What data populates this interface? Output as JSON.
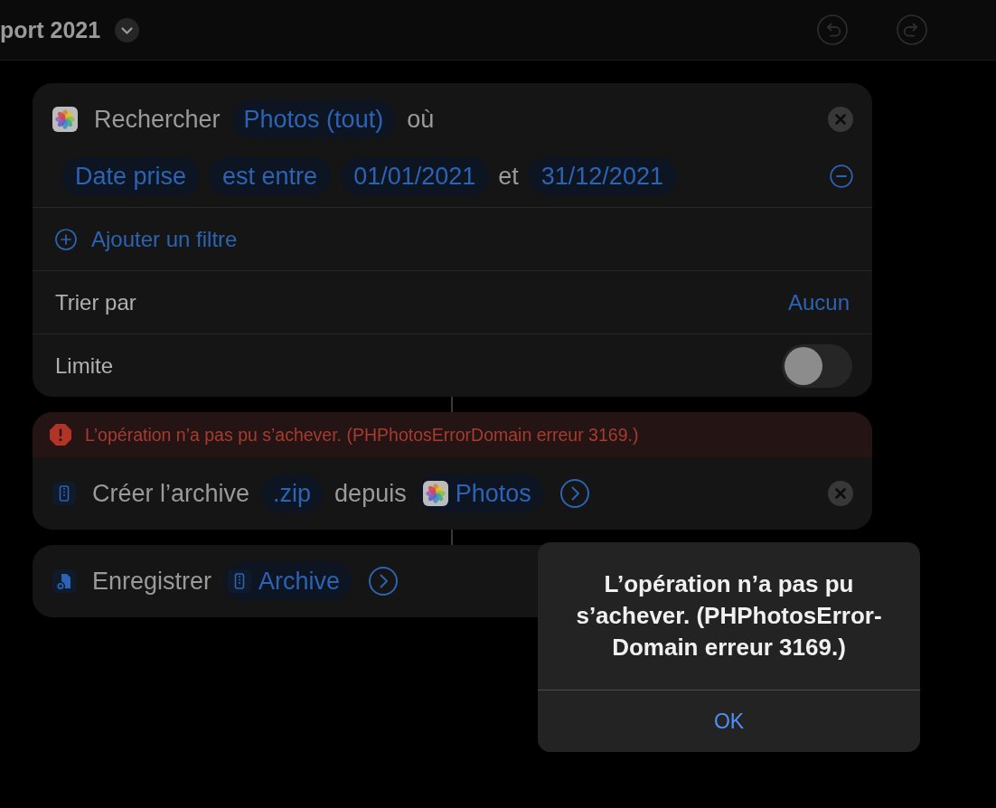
{
  "toolbar": {
    "title": "port 2021",
    "buttons": [
      {
        "kind": "undo",
        "disabled": true
      },
      {
        "kind": "redo",
        "disabled": true
      }
    ]
  },
  "actions": [
    {
      "kind": "search",
      "removable": true,
      "expandable": false,
      "tokens": [
        {
          "kind": "text",
          "text": "Rechercher"
        },
        {
          "kind": "param",
          "text": "Photos (tout)"
        },
        {
          "kind": "text",
          "text": "où"
        }
      ],
      "filters": [
        {
          "tokens": [
            {
              "kind": "param",
              "text": "Date prise"
            },
            {
              "kind": "param",
              "text": "est entre"
            },
            {
              "kind": "param",
              "text": "01/01/2021"
            },
            {
              "kind": "text",
              "text": "et"
            },
            {
              "kind": "param",
              "text": "31/12/2021"
            }
          ]
        }
      ],
      "add_filter": "Ajouter un filtre",
      "options": [
        {
          "kind": "value",
          "label": "Trier par",
          "value": "Aucun"
        },
        {
          "kind": "toggle",
          "label": "Limite",
          "on": false
        }
      ]
    },
    {
      "kind": "archive",
      "error": "L’opération n’a pas pu s’achever. (PHPhotosErrorDomain erreur 3169.)",
      "removable": true,
      "expandable": true,
      "tokens": [
        {
          "kind": "text",
          "text": "Créer l’archive"
        },
        {
          "kind": "param",
          "text": ".zip"
        },
        {
          "kind": "text",
          "text": "depuis"
        },
        {
          "kind": "photos",
          "text": "Photos"
        }
      ]
    },
    {
      "kind": "save",
      "removable": false,
      "expandable": true,
      "tokens": [
        {
          "kind": "text",
          "text": "Enregistrer"
        },
        {
          "kind": "archive",
          "text": "Archive"
        }
      ]
    }
  ],
  "alert": {
    "message": "L’opération n’a pas pu s’achever. (PHPhotosError-Domain erreur 3169.)",
    "buttons": [
      "OK"
    ]
  }
}
